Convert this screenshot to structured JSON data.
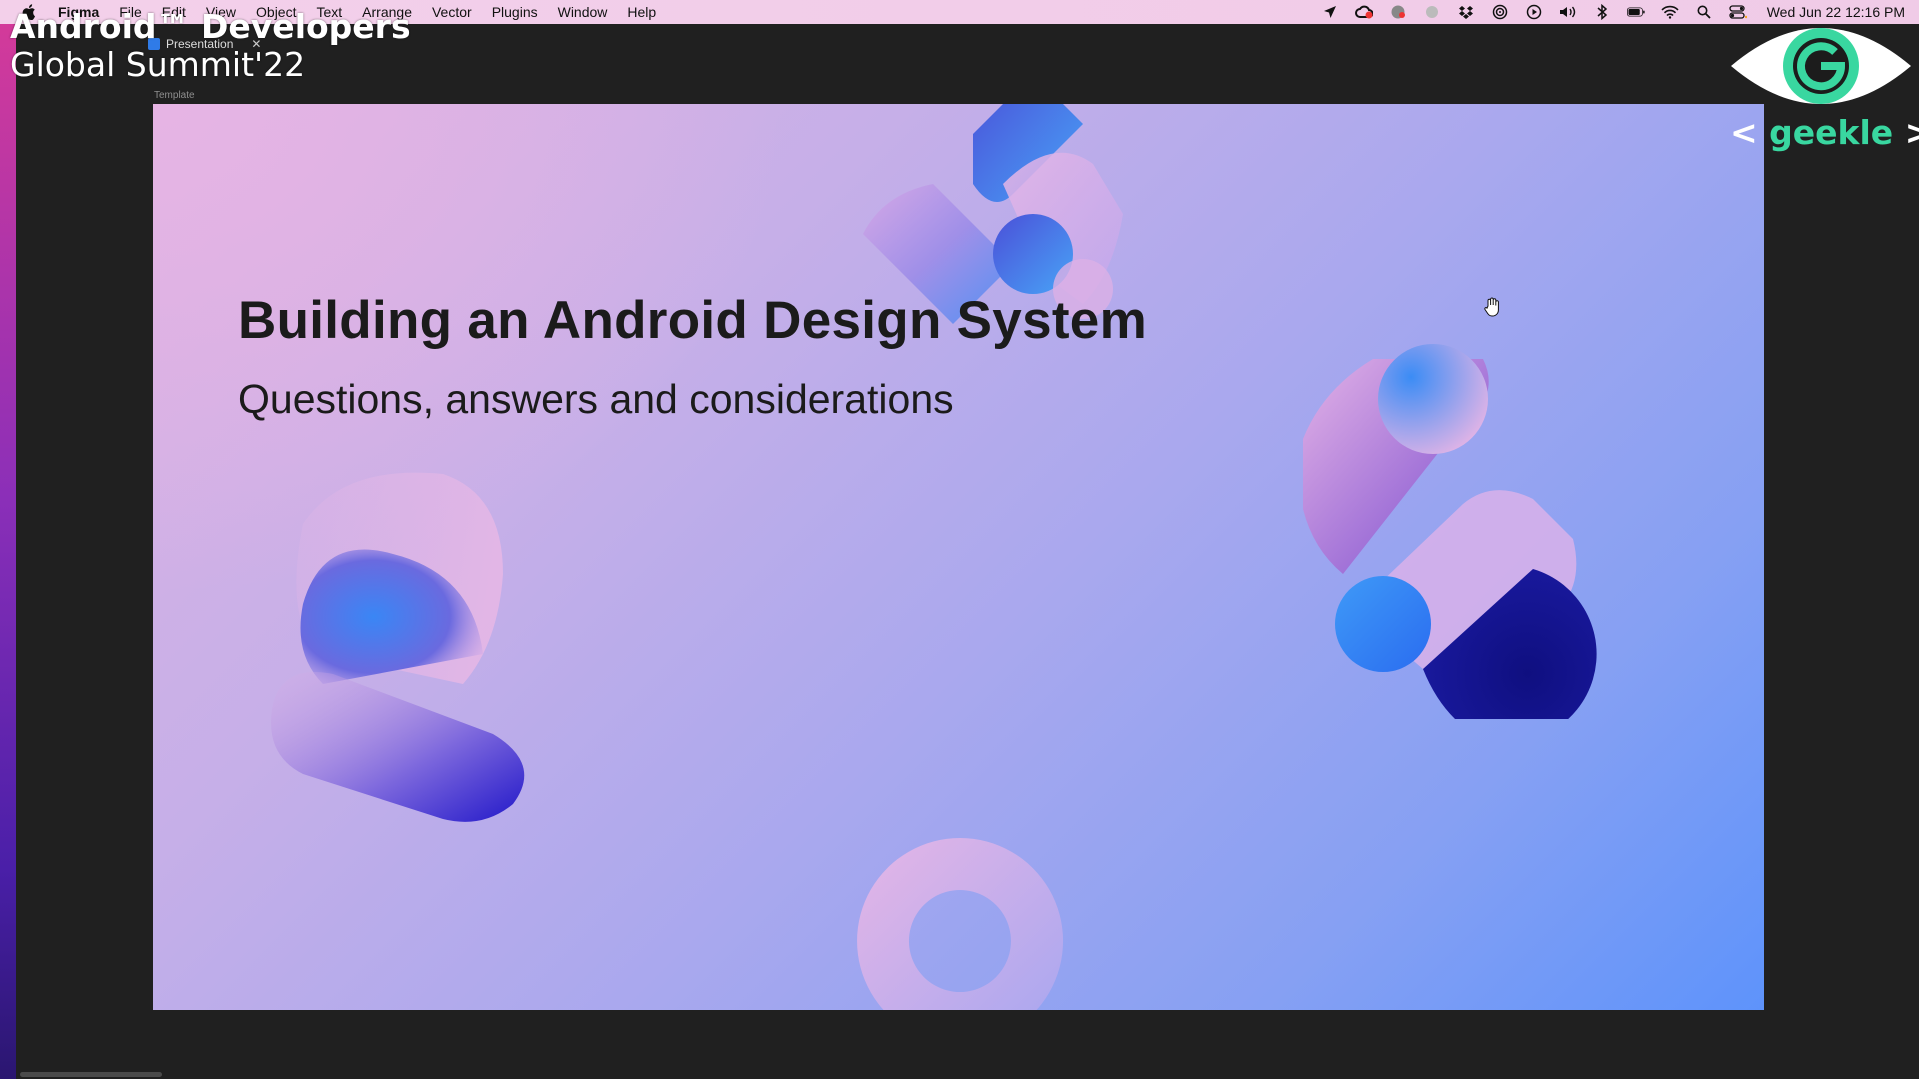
{
  "menubar": {
    "app_name": "Figma",
    "items": [
      "File",
      "Edit",
      "View",
      "Object",
      "Text",
      "Arrange",
      "Vector",
      "Plugins",
      "Window",
      "Help"
    ],
    "clock": "Wed Jun 22  12:16 PM",
    "status_icons": [
      "location-icon",
      "creative-cloud-icon",
      "vpn-icon",
      "dot-icon",
      "dropbox-icon",
      "airdrop-icon",
      "play-icon",
      "volume-icon",
      "bluetooth-icon",
      "battery-icon",
      "wifi-icon",
      "spotlight-search-icon",
      "control-center-icon"
    ]
  },
  "figma": {
    "tab_title": "Presentation",
    "frame_label": "Template"
  },
  "slide": {
    "title": "Building an Android Design System",
    "subtitle": "Questions, answers and considerations"
  },
  "overlay": {
    "event_line1": "Android™ Developers",
    "event_line2": "Global Summit'22",
    "brand_left": "<",
    "brand_name": "geekle",
    "brand_right": ">"
  },
  "colors": {
    "brand_green": "#39d7a0",
    "slide_gradient_start": "#dcb2e3",
    "slide_gradient_end": "#5e93fb"
  }
}
